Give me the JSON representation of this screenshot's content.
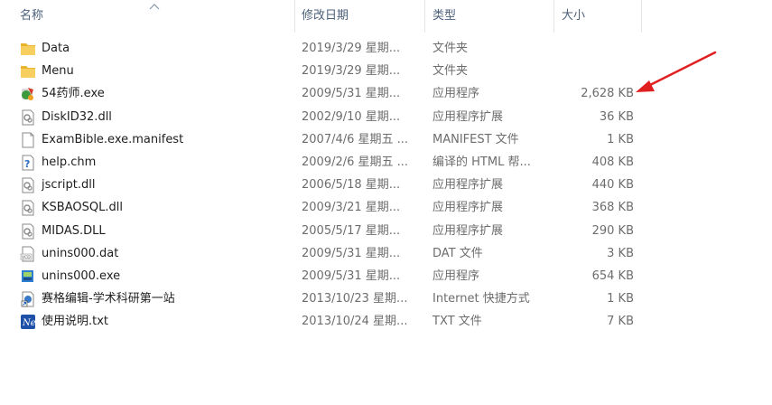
{
  "columns": {
    "name": "名称",
    "date": "修改日期",
    "type": "类型",
    "size": "大小"
  },
  "files": [
    {
      "name": "Data",
      "date": "2019/3/29 星期...",
      "type": "文件夹",
      "size": "",
      "icon": "folder-icon"
    },
    {
      "name": "Menu",
      "date": "2019/3/29 星期...",
      "type": "文件夹",
      "size": "",
      "icon": "folder-icon"
    },
    {
      "name": "54药师.exe",
      "date": "2009/5/31 星期...",
      "type": "应用程序",
      "size": "2,628 KB",
      "icon": "app-exe-icon"
    },
    {
      "name": "DiskID32.dll",
      "date": "2002/9/10 星期...",
      "type": "应用程序扩展",
      "size": "36 KB",
      "icon": "dll-icon"
    },
    {
      "name": "ExamBible.exe.manifest",
      "date": "2007/4/6 星期五 ...",
      "type": "MANIFEST 文件",
      "size": "1 KB",
      "icon": "blank-file-icon"
    },
    {
      "name": "help.chm",
      "date": "2009/2/6 星期五 ...",
      "type": "编译的 HTML 帮...",
      "size": "408 KB",
      "icon": "chm-help-icon"
    },
    {
      "name": "jscript.dll",
      "date": "2006/5/18 星期...",
      "type": "应用程序扩展",
      "size": "440 KB",
      "icon": "dll-icon"
    },
    {
      "name": "KSBAOSQL.dll",
      "date": "2009/3/21 星期...",
      "type": "应用程序扩展",
      "size": "368 KB",
      "icon": "dll-icon"
    },
    {
      "name": "MIDAS.DLL",
      "date": "2005/5/17 星期...",
      "type": "应用程序扩展",
      "size": "290 KB",
      "icon": "dll-icon"
    },
    {
      "name": "unins000.dat",
      "date": "2009/5/31 星期...",
      "type": "DAT 文件",
      "size": "3 KB",
      "icon": "dat-file-icon"
    },
    {
      "name": "unins000.exe",
      "date": "2009/5/31 星期...",
      "type": "应用程序",
      "size": "654 KB",
      "icon": "installer-exe-icon"
    },
    {
      "name": "赛格编辑-学术科研第一站",
      "date": "2013/10/23 星期...",
      "type": "Internet 快捷方式",
      "size": "1 KB",
      "icon": "internet-shortcut-icon"
    },
    {
      "name": "使用说明.txt",
      "date": "2013/10/24 星期...",
      "type": "TXT 文件",
      "size": "7 KB",
      "icon": "txt-notepad-icon"
    }
  ],
  "colors": {
    "header_text": "#4c607a",
    "folder": "#f2c553",
    "annotation_arrow": "#e02020"
  }
}
